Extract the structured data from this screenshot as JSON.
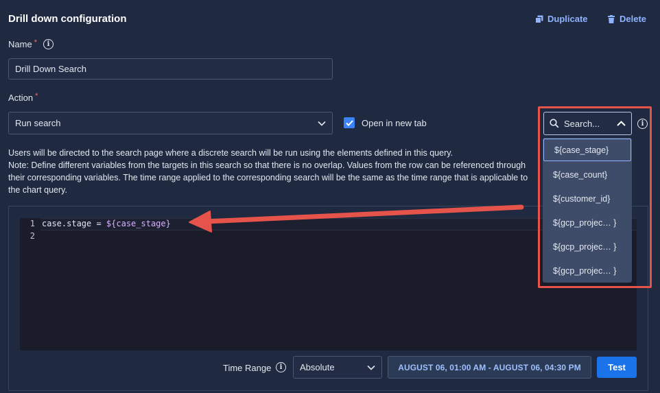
{
  "header": {
    "title": "Drill down configuration",
    "duplicate_label": "Duplicate",
    "delete_label": "Delete"
  },
  "name_field": {
    "label": "Name",
    "required_mark": "*",
    "value": "Drill Down Search"
  },
  "action_field": {
    "label": "Action",
    "required_mark": "*",
    "selected": "Run search"
  },
  "open_new_tab": {
    "label": "Open in new tab",
    "checked": true
  },
  "description": {
    "line1": "Users will be directed to the search page where a discrete search will be run using the elements defined in this query.",
    "line2": "Note: Define different variables from the targets in this search so that there is no overlap. Values from the row can be referenced through their corresponding variables. The time range applied to the corresponding search will be the same as the time range that is applicable to the chart query."
  },
  "editor": {
    "line_numbers": [
      "1",
      "2"
    ],
    "line1_prefix": "case.stage = ",
    "line1_var": "${case_stage}",
    "line2": ""
  },
  "variables_dropdown": {
    "search_placeholder": "Search...",
    "items": [
      "${case_stage}",
      "${case_count}",
      "${customer_id}",
      "${gcp_projec… }",
      "${gcp_projec… }",
      "${gcp_projec… }"
    ],
    "selected_index": 0
  },
  "time_range": {
    "label": "Time Range",
    "mode": "Absolute",
    "range_text": "AUGUST 06, 01:00 AM - AUGUST 06, 04:30 PM",
    "test_label": "Test"
  },
  "colors": {
    "background": "#1f2a40",
    "accent": "#1a73e8",
    "link": "#8fb3ff",
    "annotation": "#e5534b",
    "required": "#ff6b6b"
  },
  "icons": [
    "duplicate-icon",
    "trash-icon",
    "info-icon",
    "chevron-down-icon",
    "checkmark-icon",
    "search-icon",
    "chevron-up-icon"
  ]
}
